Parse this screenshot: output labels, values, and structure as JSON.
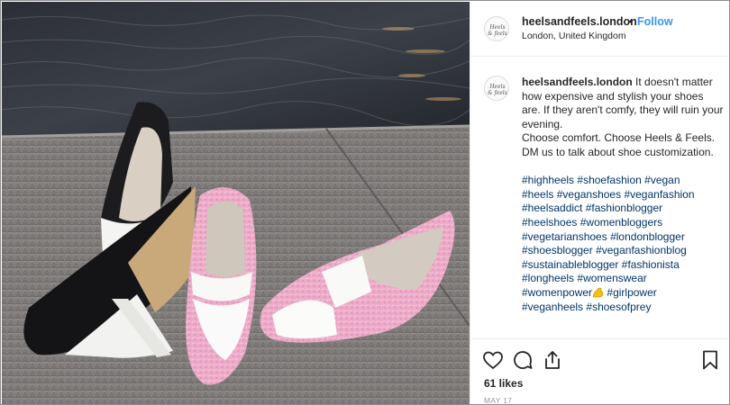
{
  "post": {
    "username": "heelsandfeels.london",
    "separator": "•",
    "follow_label": "Follow",
    "location": "London, United Kingdom",
    "avatar_text": "Heels & feels"
  },
  "caption": {
    "username": "heelsandfeels.london",
    "lines": [
      "It doesn't matter how expensive and stylish your shoes are. If they aren't comfy, they will ruin your evening.",
      "Choose comfort. Choose Heels & Feels.",
      "DM us to talk about shoe customization."
    ],
    "hashtags": [
      [
        "#highheels",
        "#shoefashion",
        "#vegan"
      ],
      [
        "#heels",
        "#veganshoes",
        "#veganfashion"
      ],
      [
        "#heelsaddict",
        "#fashionblogger"
      ],
      [
        "#heelshoes",
        "#womenbloggers"
      ],
      [
        "#vegetarianshoes",
        "#londonblogger"
      ],
      [
        "#shoesblogger",
        "#veganfashionblog"
      ],
      [
        "#sustainableblogger",
        "#fashionista"
      ],
      [
        "#longheels",
        "#womenswear"
      ],
      [
        "#womenpower",
        "#girlpower"
      ],
      [
        "#veganheels",
        "#shoesofprey"
      ]
    ]
  },
  "actions": {
    "icons": [
      "heart-icon",
      "comment-icon",
      "share-icon",
      "bookmark-icon"
    ],
    "likes": "61 likes",
    "date": "MAY 17"
  },
  "colors": {
    "link": "#3897f0",
    "hashtag": "#003569",
    "text": "#262626",
    "muted": "#999999",
    "glitter_pink": "#f0a7c6"
  }
}
